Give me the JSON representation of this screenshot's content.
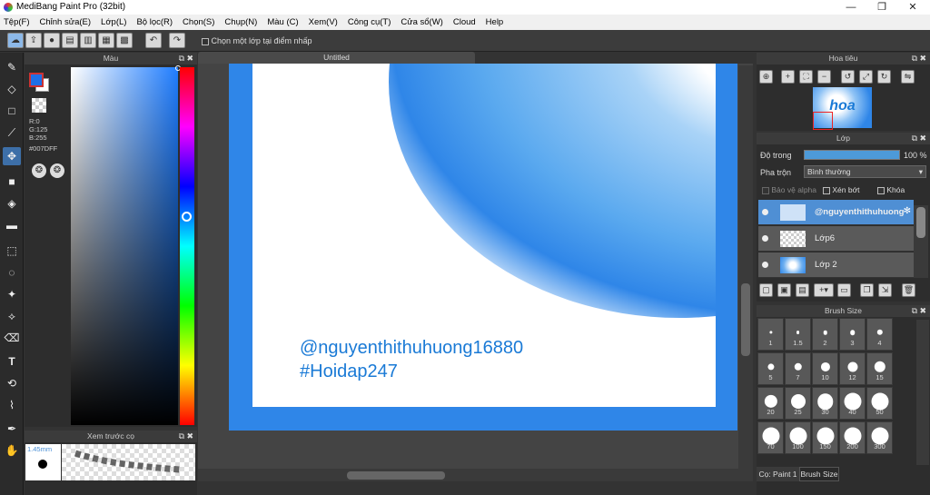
{
  "app": {
    "title": "MediBang Paint Pro (32bit)"
  },
  "menu": [
    "Tệp(F)",
    "Chỉnh sửa(E)",
    "Lớp(L)",
    "Bộ lọc(R)",
    "Chọn(S)",
    "Chụp(N)",
    "Màu (C)",
    "Xem(V)",
    "Công cụ(T)",
    "Cửa sổ(W)",
    "Cloud",
    "Help"
  ],
  "toolbar": {
    "checkbox_label": "Chọn một lớp tại điểm nhấp"
  },
  "color_panel": {
    "title": "Màu",
    "r": "R:0",
    "g": "G:125",
    "b": "B:255",
    "hex": "#007DFF",
    "fg": "#007DFF",
    "bg": "#ffffff"
  },
  "brush_preview": {
    "title": "Xem trước cọ",
    "size": "1.45mm"
  },
  "canvas": {
    "tab": "Untitled",
    "line1": "@nguyenthithuhuong16880",
    "line2": "#Hoidap247"
  },
  "navigator": {
    "title": "Hoa tiêu",
    "thumb_text": "hoa"
  },
  "layer_panel": {
    "title": "Lớp",
    "opacity_label": "Độ trong",
    "opacity_value": "100 %",
    "opacity": 1.0,
    "blend_label": "Pha trộn",
    "blend_value": "Bình thường",
    "protect_alpha": "Bảo vệ alpha",
    "clipping": "Xén bớt",
    "lock": "Khóa",
    "layers": [
      {
        "name": "@nguyenthithuhuong",
        "selected": true
      },
      {
        "name": "Lớp6",
        "selected": false
      },
      {
        "name": "Lớp 2",
        "selected": false
      }
    ]
  },
  "brush_size": {
    "title": "Brush Size",
    "sizes": [
      "1",
      "1.5",
      "2",
      "3",
      "4",
      "5",
      "7",
      "10",
      "12",
      "15",
      "20",
      "25",
      "30",
      "40",
      "50",
      "70",
      "100",
      "150",
      "200",
      "300"
    ]
  },
  "bottom_tabs": {
    "tab1": "Cọ: Paint 1",
    "tab2": "Brush Size"
  }
}
